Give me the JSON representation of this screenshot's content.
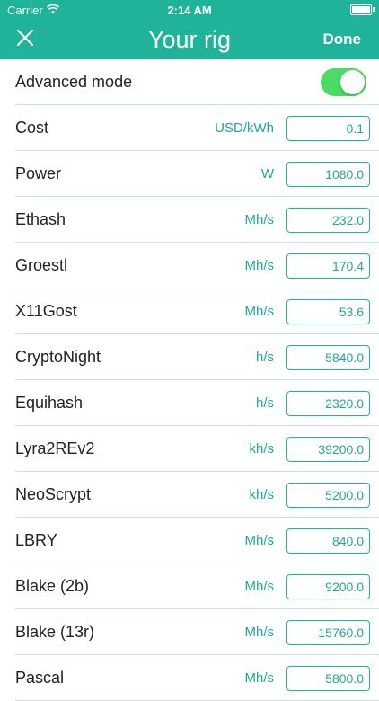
{
  "status_bar": {
    "carrier": "Carrier",
    "time": "2:14 AM"
  },
  "nav": {
    "title": "Your rig",
    "done_label": "Done"
  },
  "advanced_mode": {
    "label": "Advanced mode",
    "enabled": true
  },
  "rows": [
    {
      "label": "Cost",
      "unit": "USD/kWh",
      "value": "0.1"
    },
    {
      "label": "Power",
      "unit": "W",
      "value": "1080.0"
    },
    {
      "label": "Ethash",
      "unit": "Mh/s",
      "value": "232.0"
    },
    {
      "label": "Groestl",
      "unit": "Mh/s",
      "value": "170.4"
    },
    {
      "label": "X11Gost",
      "unit": "Mh/s",
      "value": "53.6"
    },
    {
      "label": "CryptoNight",
      "unit": "h/s",
      "value": "5840.0"
    },
    {
      "label": "Equihash",
      "unit": "h/s",
      "value": "2320.0"
    },
    {
      "label": "Lyra2REv2",
      "unit": "kh/s",
      "value": "39200.0"
    },
    {
      "label": "NeoScrypt",
      "unit": "kh/s",
      "value": "5200.0"
    },
    {
      "label": "LBRY",
      "unit": "Mh/s",
      "value": "840.0"
    },
    {
      "label": "Blake (2b)",
      "unit": "Mh/s",
      "value": "9200.0"
    },
    {
      "label": "Blake (13r)",
      "unit": "Mh/s",
      "value": "15760.0"
    },
    {
      "label": "Pascal",
      "unit": "Mh/s",
      "value": "5800.0"
    }
  ],
  "colors": {
    "accent": "#1fb39a",
    "toggle_on": "#4cd964",
    "separator": "#c5e6df"
  },
  "icons": {
    "close": "close-icon",
    "wifi": "wifi-icon",
    "battery": "battery-icon"
  }
}
